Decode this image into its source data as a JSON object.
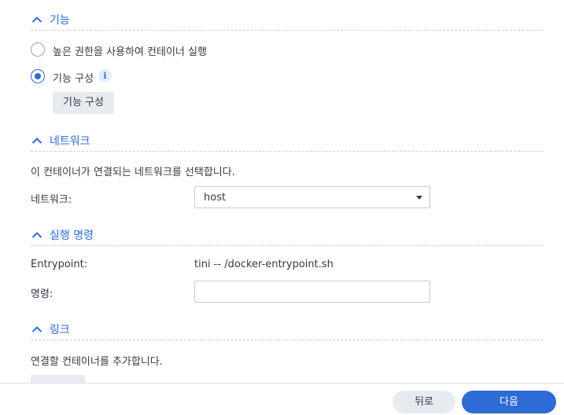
{
  "sections": {
    "capabilities": {
      "title": "기능",
      "option_privileged": "높은 권한을 사용하여 컨테이너 실행",
      "option_configure": "기능 구성",
      "configure_button": "기능 구성",
      "selected": "option_configure"
    },
    "network": {
      "title": "네트워크",
      "description": "이 컨테이너가 연결되는 네트워크를 선택합니다.",
      "field_label": "네트워크:",
      "selected_value": "host"
    },
    "execution": {
      "title": "실행 명령",
      "entrypoint_label": "Entrypoint:",
      "entrypoint_value": "tini -- /docker-entrypoint.sh",
      "command_label": "명령:",
      "command_value": ""
    },
    "links": {
      "title": "링크",
      "description": "연결할 컨테이너를 추가합니다."
    }
  },
  "footer": {
    "back_label": "뒤로",
    "next_label": "다음"
  },
  "colors": {
    "accent": "#2e6bd4",
    "button_gray": "#e7ebef"
  },
  "icons": {
    "collapse": "chevron-up-icon",
    "info": "info-icon",
    "dropdown": "caret-down-icon"
  }
}
